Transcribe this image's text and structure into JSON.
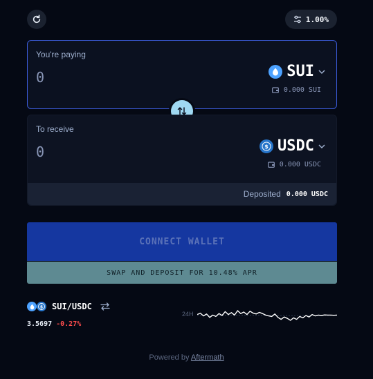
{
  "header": {
    "slippage": "1.00%"
  },
  "pay": {
    "label": "You're paying",
    "amount": "0",
    "token": "SUI",
    "balance": "0.000 SUI"
  },
  "receive": {
    "label": "To receive",
    "amount": "0",
    "token": "USDC",
    "balance": "0.000 USDC",
    "deposited_label": "Deposited",
    "deposited_value": "0.000 USDC"
  },
  "actions": {
    "connect_wallet": "CONNECT WALLET",
    "swap_and_deposit": "SWAP AND DEPOSIT FOR 10.48% APR"
  },
  "market": {
    "pair": "SUI/USDC",
    "price": "3.5697",
    "change": "-0.27%",
    "range": "24H",
    "sparkline": [
      0.55,
      0.62,
      0.48,
      0.58,
      0.4,
      0.52,
      0.45,
      0.6,
      0.5,
      0.7,
      0.55,
      0.65,
      0.52,
      0.75,
      0.6,
      0.68,
      0.55,
      0.72,
      0.62,
      0.58,
      0.66,
      0.6,
      0.52,
      0.48,
      0.45,
      0.58,
      0.4,
      0.3,
      0.42,
      0.35,
      0.25,
      0.38,
      0.3,
      0.45,
      0.38,
      0.5,
      0.42,
      0.55,
      0.48,
      0.52,
      0.5,
      0.53,
      0.52,
      0.52,
      0.51,
      0.52
    ]
  },
  "footer": {
    "powered_by": "Powered by",
    "brand": "Aftermath"
  },
  "colors": {
    "accent_border": "#3b5bd9",
    "connect_bg": "#1537a0",
    "deposit_bg": "#5e8a92",
    "negative": "#ff4d4d",
    "swap_button": "#9fd8f2"
  }
}
